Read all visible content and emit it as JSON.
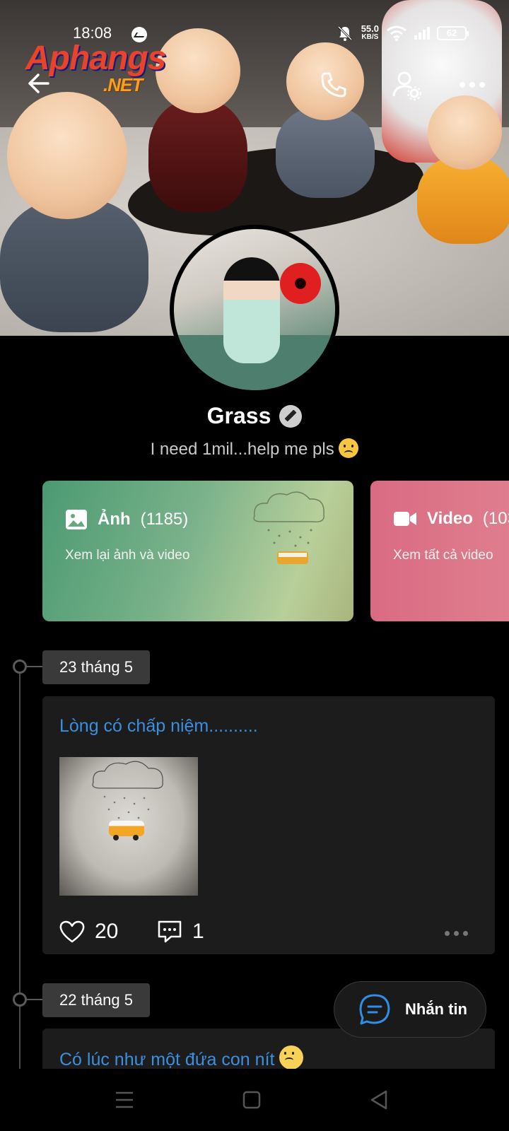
{
  "status_bar": {
    "time": "18:08",
    "net_speed": "55.0",
    "net_unit": "KB/S",
    "battery": "62"
  },
  "watermark": {
    "brand": "Aphangs",
    "tld": ".NET"
  },
  "profile": {
    "name": "Grass",
    "status": "I need 1mil...help me pls"
  },
  "media_cards": [
    {
      "title": "Ảnh",
      "count": "(1185)",
      "subtitle": "Xem lại ảnh và video",
      "icon": "image-icon"
    },
    {
      "title": "Video",
      "count": "(103",
      "subtitle": "Xem tất cả video",
      "icon": "video-camera-icon"
    }
  ],
  "timeline": [
    {
      "date": "23 tháng 5",
      "text": "Lòng có chấp niệm..........",
      "likes": "20",
      "comments": "1"
    },
    {
      "date": "22 tháng 5",
      "text": "Có lúc như một đứa con nít"
    }
  ],
  "message_button": {
    "label": "Nhắn tin"
  },
  "colors": {
    "background": "#000000",
    "post_link": "#3b8fe0",
    "photo_card": "#4b9a72",
    "video_card": "#d96b82"
  }
}
